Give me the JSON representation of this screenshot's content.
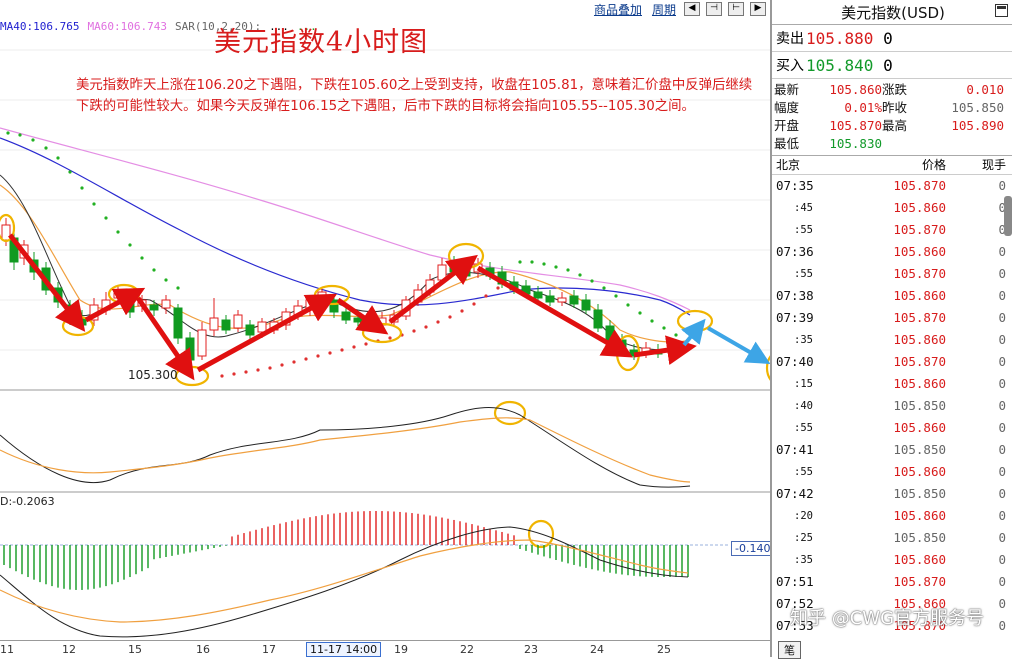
{
  "title": "美元指数4小时图",
  "commentary": "美元指数昨天上涨在106.20之下遇阻，下跌在105.60之上受到支持，收盘在105.81，意味着汇价盘中反弹后继续下跌的可能性较大。如果今天反弹在106.15之下遇阻，后市下跌的目标将会指向105.55--105.30之间。",
  "toolbar": {
    "overlay_label": "商品叠加",
    "period_label": "周期"
  },
  "ma_legend": [
    {
      "text": "MA40:106.765",
      "color": "#1f1fd0"
    },
    {
      "text": "MA60:106.743",
      "color": "#e070e0"
    },
    {
      "text": "SAR(10,2,20):",
      "color": "#666666"
    },
    {
      "text": "...",
      "color": "#000000"
    },
    {
      "text": "...",
      "color": "#22a022"
    }
  ],
  "low_label": "105.300",
  "macd_label": "D:-0.2063",
  "macd_value": "-0.140",
  "x_axis": [
    {
      "text": "11",
      "hl": false
    },
    {
      "text": "12",
      "hl": false
    },
    {
      "text": "15",
      "hl": false
    },
    {
      "text": "16",
      "hl": false
    },
    {
      "text": "17",
      "hl": false
    },
    {
      "text": "11-17 14:00",
      "hl": true
    },
    {
      "text": "19",
      "hl": false
    },
    {
      "text": "22",
      "hl": false
    },
    {
      "text": "23",
      "hl": false
    },
    {
      "text": "24",
      "hl": false
    },
    {
      "text": "25",
      "hl": false
    }
  ],
  "quote": {
    "name": "美元指数(USD)",
    "sell_label": "卖出",
    "sell_price": "105.880",
    "sell_vol": "0",
    "buy_label": "买入",
    "buy_price": "105.840",
    "buy_vol": "0",
    "stats": [
      {
        "k": "最新",
        "v": "105.860",
        "c": "red",
        "k2": "涨跌",
        "v2": "0.010",
        "c2": "red"
      },
      {
        "k": "幅度",
        "v": "0.01%",
        "c": "red",
        "k2": "昨收",
        "v2": "105.850",
        "c2": "gray"
      },
      {
        "k": "开盘",
        "v": "105.870",
        "c": "red",
        "k2": "最高",
        "v2": "105.890",
        "c2": "red"
      },
      {
        "k": "最低",
        "v": "105.830",
        "c": "green",
        "k2": "",
        "v2": "",
        "c2": "gray"
      }
    ],
    "tick_header": {
      "time": "北京",
      "price": "价格",
      "vol": "现手"
    },
    "ticks": [
      {
        "t": "07:35",
        "sub": false,
        "p": "105.870",
        "c": "red",
        "v": "0"
      },
      {
        "t": ":45",
        "sub": true,
        "p": "105.860",
        "c": "red",
        "v": "0"
      },
      {
        "t": ":55",
        "sub": true,
        "p": "105.870",
        "c": "red",
        "v": "0"
      },
      {
        "t": "07:36",
        "sub": false,
        "p": "105.860",
        "c": "red",
        "v": "0"
      },
      {
        "t": ":55",
        "sub": true,
        "p": "105.870",
        "c": "red",
        "v": "0"
      },
      {
        "t": "07:38",
        "sub": false,
        "p": "105.860",
        "c": "red",
        "v": "0"
      },
      {
        "t": "07:39",
        "sub": false,
        "p": "105.870",
        "c": "red",
        "v": "0"
      },
      {
        "t": ":35",
        "sub": true,
        "p": "105.860",
        "c": "red",
        "v": "0"
      },
      {
        "t": "07:40",
        "sub": false,
        "p": "105.870",
        "c": "red",
        "v": "0"
      },
      {
        "t": ":15",
        "sub": true,
        "p": "105.860",
        "c": "red",
        "v": "0"
      },
      {
        "t": ":40",
        "sub": true,
        "p": "105.850",
        "c": "gray",
        "v": "0"
      },
      {
        "t": ":55",
        "sub": true,
        "p": "105.860",
        "c": "red",
        "v": "0"
      },
      {
        "t": "07:41",
        "sub": false,
        "p": "105.850",
        "c": "gray",
        "v": "0"
      },
      {
        "t": ":55",
        "sub": true,
        "p": "105.860",
        "c": "red",
        "v": "0"
      },
      {
        "t": "07:42",
        "sub": false,
        "p": "105.850",
        "c": "gray",
        "v": "0"
      },
      {
        "t": ":20",
        "sub": true,
        "p": "105.860",
        "c": "red",
        "v": "0"
      },
      {
        "t": ":25",
        "sub": true,
        "p": "105.850",
        "c": "gray",
        "v": "0"
      },
      {
        "t": ":35",
        "sub": true,
        "p": "105.860",
        "c": "red",
        "v": "0"
      },
      {
        "t": "07:51",
        "sub": false,
        "p": "105.870",
        "c": "red",
        "v": "0"
      },
      {
        "t": "07:52",
        "sub": false,
        "p": "105.860",
        "c": "red",
        "v": "0"
      },
      {
        "t": "07:53",
        "sub": false,
        "p": "105.870",
        "c": "red",
        "v": "0"
      }
    ]
  },
  "watermark": "知乎 @CWG官方服务号",
  "pen_label": "笔",
  "icons": {
    "nav": [
      "left-arrow-icon",
      "prev-icon",
      "next-icon",
      "right-arrow-icon"
    ],
    "panel": "window-box-icon"
  }
}
